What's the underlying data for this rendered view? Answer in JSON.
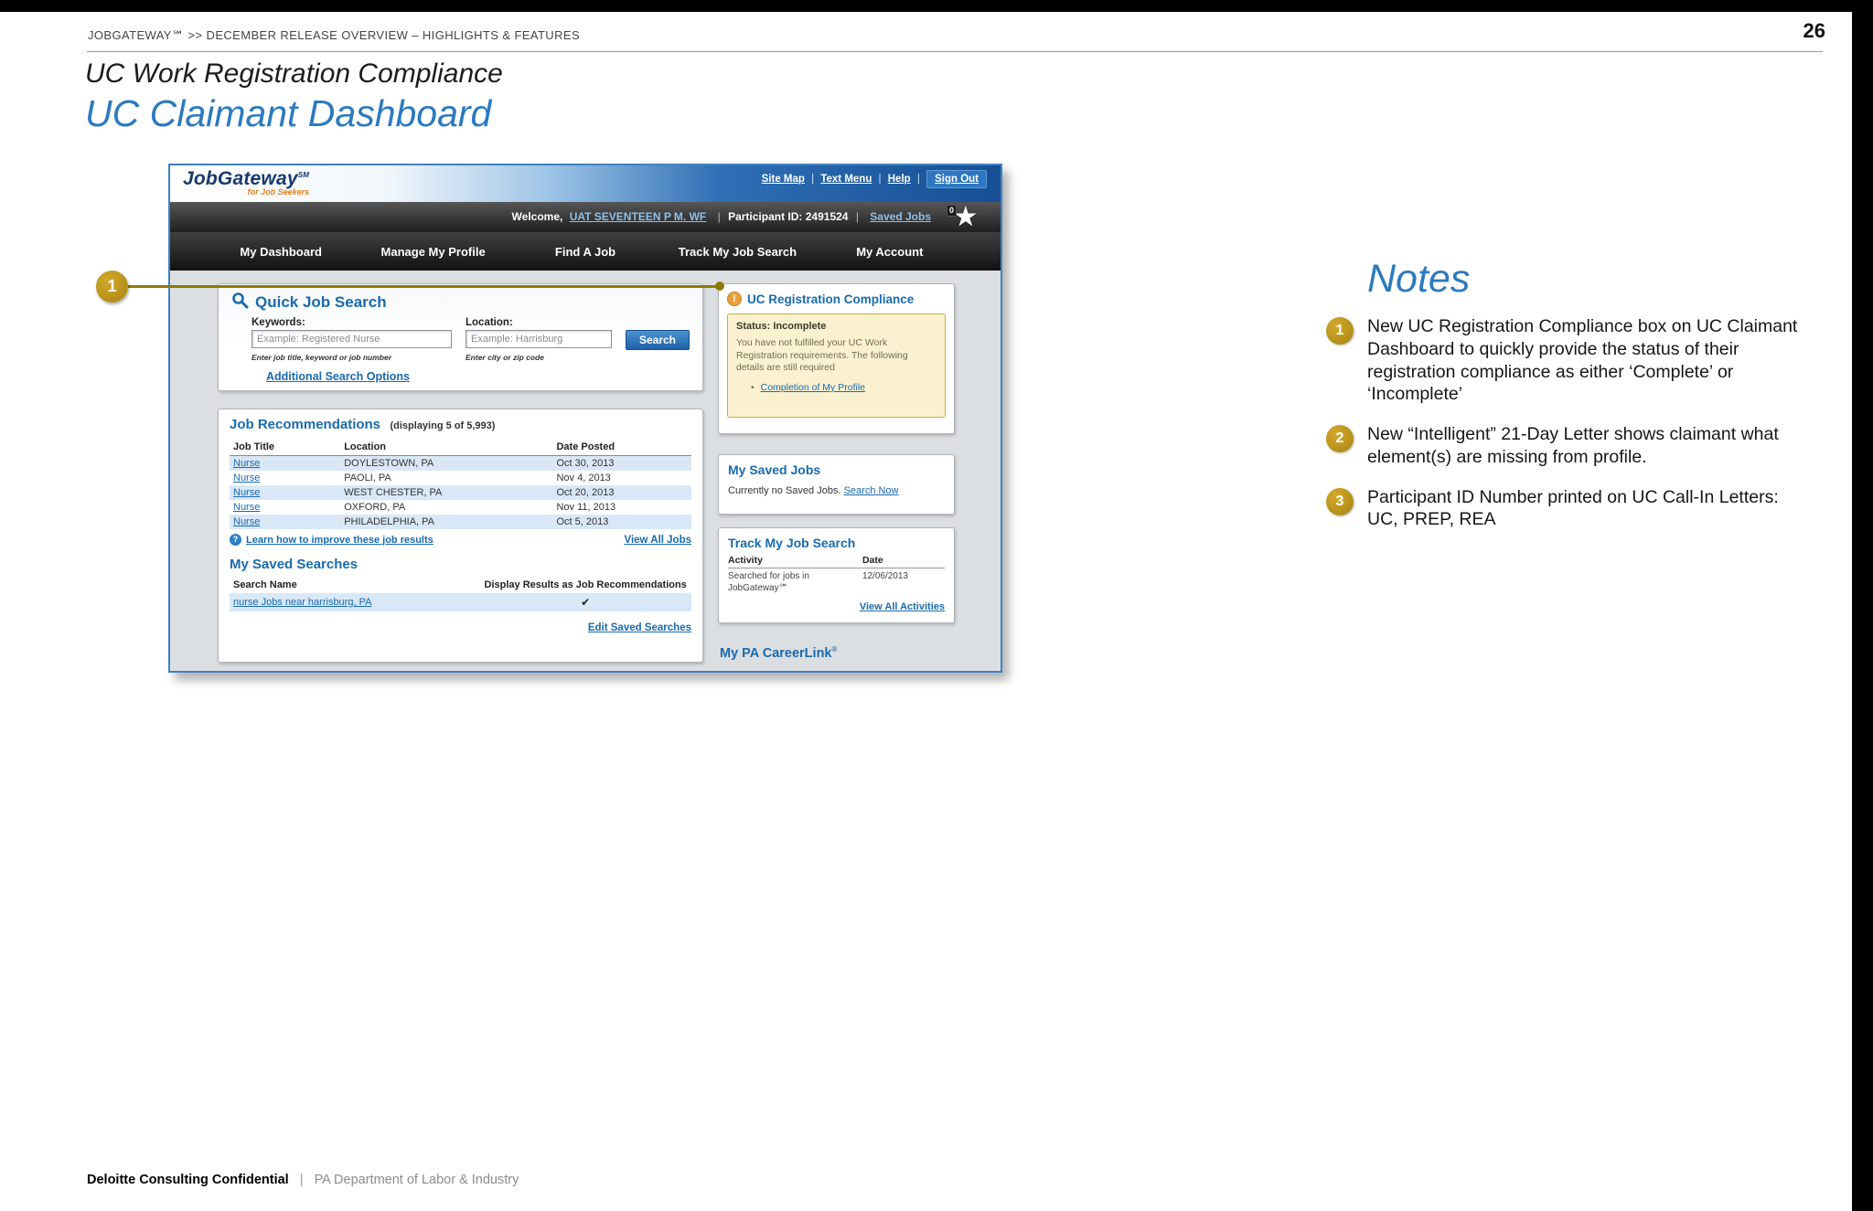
{
  "slide": {
    "breadcrumb": "JOBGATEWAY℠   >>   DECEMBER RELEASE OVERVIEW – HIGHLIGHTS & FEATURES",
    "page_number": "26",
    "title_line1": "UC Work Registration Compliance",
    "title_line2": "UC Claimant Dashboard",
    "footer_confidential": "Deloitte Consulting Confidential",
    "footer_divider": "|",
    "footer_org": "PA Department of Labor & Industry"
  },
  "callout": {
    "num": "1"
  },
  "notes": {
    "heading": "Notes",
    "items": [
      {
        "num": "1",
        "text": "New UC Registration Compliance box on UC Claimant Dashboard to quickly provide the status of their registration compliance as either ‘Complete’ or ‘Incomplete’"
      },
      {
        "num": "2",
        "text": "New “Intelligent” 21-Day Letter shows claimant what element(s) are missing from profile."
      },
      {
        "num": "3",
        "text": "Participant ID Number printed on UC Call-In Letters:  UC, PREP, REA"
      }
    ]
  },
  "app": {
    "divider": "|",
    "logo": {
      "brand": "JobGateway",
      "sm": "SM",
      "tagline": "for Job Seekers"
    },
    "top_links": {
      "site_map": "Site Map",
      "text_menu": "Text Menu",
      "help": "Help",
      "sign_out": "Sign Out"
    },
    "welcome": {
      "label": "Welcome,",
      "user": "UAT SEVENTEEN P M. WF",
      "participant": "Participant ID: 2491524",
      "saved_jobs": "Saved Jobs",
      "star_count": "0"
    },
    "nav": [
      "My Dashboard",
      "Manage My Profile",
      "Find A Job",
      "Track My Job Search",
      "My Account"
    ],
    "quick_search": {
      "title": "Quick Job Search",
      "keywords_label": "Keywords:",
      "keywords_placeholder": "Example: Registered Nurse",
      "keywords_hint": "Enter job title, keyword or job number",
      "location_label": "Location:",
      "location_placeholder": "Example: Harrisburg",
      "location_hint": "Enter city or zip code",
      "search_button": "Search",
      "additional_link": "Additional Search Options"
    },
    "job_recs": {
      "title": "Job Recommendations",
      "subtitle": "(displaying 5 of 5,993)",
      "columns": [
        "Job Title",
        "Location",
        "Date Posted"
      ],
      "rows": [
        {
          "title": "Nurse",
          "location": "DOYLESTOWN, PA",
          "date": "Oct 30, 2013"
        },
        {
          "title": "Nurse",
          "location": "PAOLI, PA",
          "date": "Nov 4, 2013"
        },
        {
          "title": "Nurse",
          "location": "WEST CHESTER, PA",
          "date": "Oct 20, 2013"
        },
        {
          "title": "Nurse",
          "location": "OXFORD, PA",
          "date": "Nov 11, 2013"
        },
        {
          "title": "Nurse",
          "location": "PHILADELPHIA, PA",
          "date": "Oct 5, 2013"
        }
      ],
      "improve_link": "Learn how to improve these job results",
      "view_all": "View All Jobs"
    },
    "saved_searches": {
      "title": "My Saved Searches",
      "col1": "Search Name",
      "col2": "Display Results as Job Recommendations",
      "row_link": "nurse Jobs near harrisburg, PA",
      "check": "✔",
      "edit_link": "Edit Saved Searches"
    },
    "uc_compliance": {
      "title": "UC Registration Compliance",
      "status": "Status: Incomplete",
      "body": "You have not fulfilled your UC Work Registration requirements. The following details are still required",
      "bullet": "•",
      "bullet_link": "Completion of My Profile"
    },
    "saved_jobs_panel": {
      "title": "My Saved Jobs",
      "text": "Currently no Saved Jobs.",
      "link": "Search Now"
    },
    "track_panel": {
      "title": "Track My Job Search",
      "col1": "Activity",
      "col2": "Date",
      "row_activity": "Searched for jobs in JobGateway℠",
      "row_date": "12/06/2013",
      "view_all": "View All Activities"
    },
    "careerlink": {
      "title": "My PA CareerLink",
      "reg": "®"
    }
  }
}
